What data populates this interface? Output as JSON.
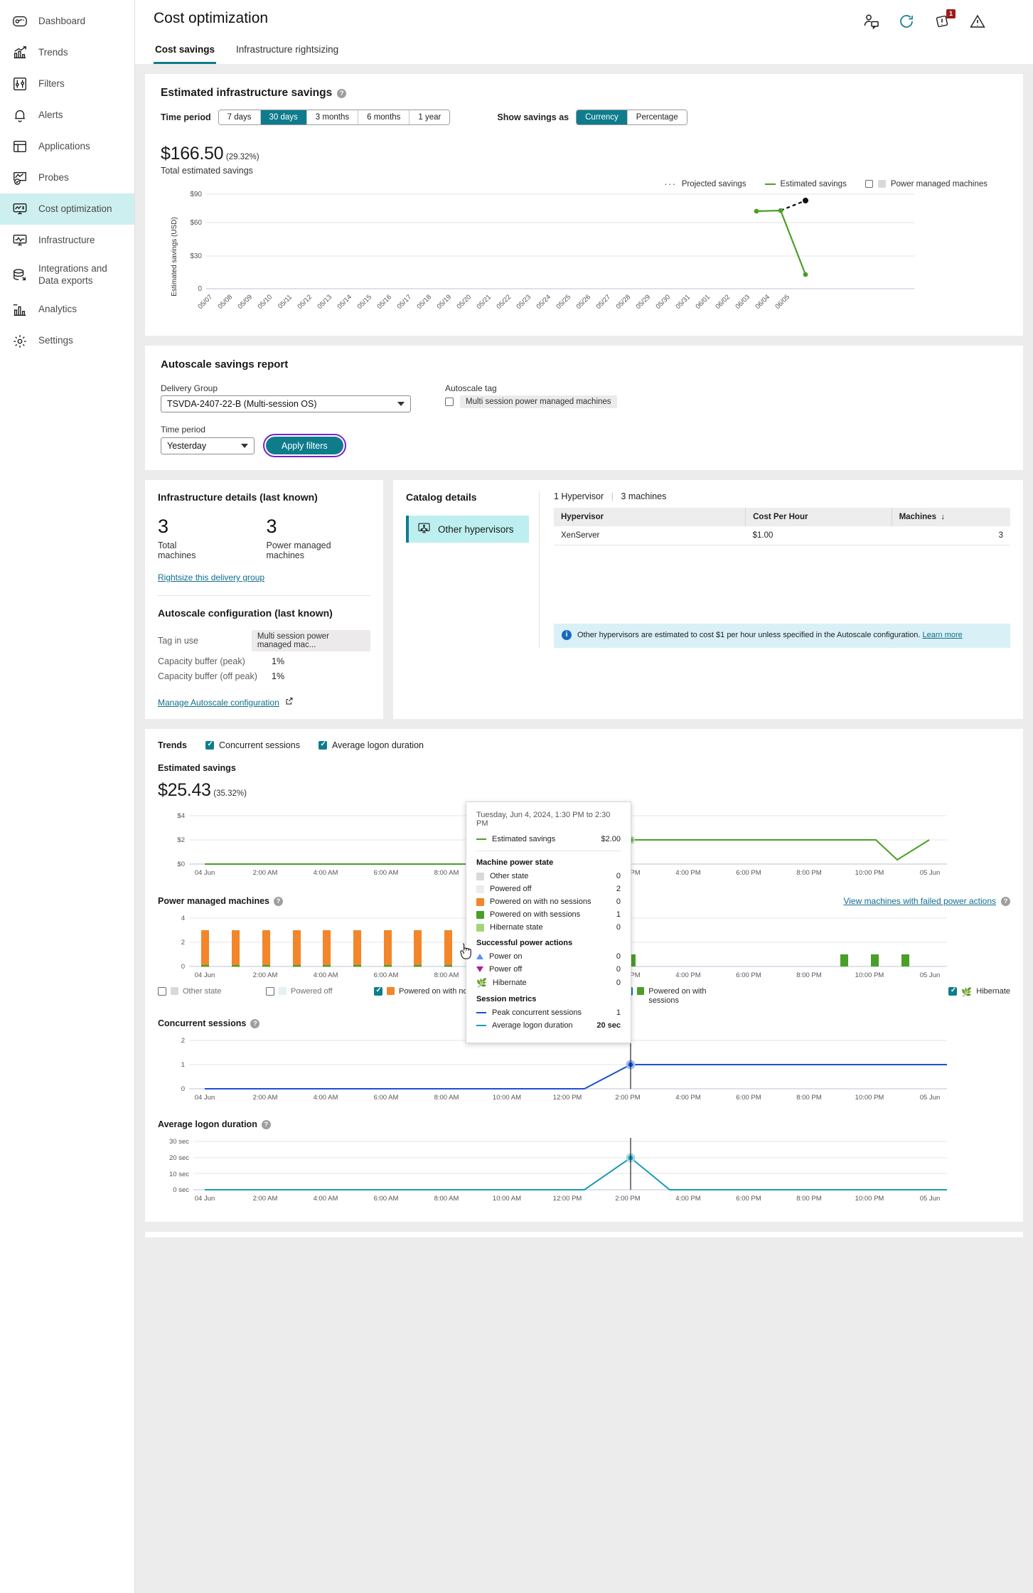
{
  "sidebar": {
    "items": [
      {
        "label": "Dashboard",
        "icon": "gauge-icon",
        "active": false
      },
      {
        "label": "Trends",
        "icon": "trend-chart-icon",
        "active": false
      },
      {
        "label": "Filters",
        "icon": "sliders-icon",
        "active": false
      },
      {
        "label": "Alerts",
        "icon": "bell-icon",
        "active": false
      },
      {
        "label": "Applications",
        "icon": "window-icon",
        "active": false
      },
      {
        "label": "Probes",
        "icon": "probe-check-icon",
        "active": false
      },
      {
        "label": "Cost optimization",
        "icon": "monitor-dollar-icon",
        "active": true
      },
      {
        "label": "Infrastructure",
        "icon": "monitor-pulse-icon",
        "active": false
      },
      {
        "label": "Integrations and Data exports",
        "icon": "stack-export-icon",
        "active": false
      },
      {
        "label": "Analytics",
        "icon": "analytics-bar-icon",
        "active": false
      },
      {
        "label": "Settings",
        "icon": "gear-icon",
        "active": false
      }
    ]
  },
  "header": {
    "title": "Cost optimization",
    "icons": [
      {
        "name": "user-feedback-icon",
        "badge": null
      },
      {
        "name": "refresh-icon",
        "badge": null
      },
      {
        "name": "alerts-diamond-icon",
        "badge": "1"
      },
      {
        "name": "warning-triangle-icon",
        "badge": null
      }
    ],
    "tabs": [
      {
        "label": "Cost savings",
        "active": true
      },
      {
        "label": "Infrastructure rightsizing",
        "active": false
      }
    ]
  },
  "infra_savings": {
    "title": "Estimated infrastructure savings",
    "time_period_label": "Time period",
    "time_periods": [
      "7 days",
      "30 days",
      "3 months",
      "6 months",
      "1 year"
    ],
    "time_period_selected": "30 days",
    "show_savings_label": "Show savings as",
    "savings_modes": [
      "Currency",
      "Percentage"
    ],
    "savings_mode_selected": "Currency",
    "total_value": "$166.50",
    "total_pct": "(29.32%)",
    "total_caption": "Total estimated savings",
    "legend": [
      {
        "label": "Projected savings",
        "style": "dotted"
      },
      {
        "label": "Estimated savings",
        "style": "line"
      },
      {
        "label": "Power managed machines",
        "style": "checkbox",
        "checked": false
      }
    ]
  },
  "autoscale_report": {
    "title": "Autoscale savings report",
    "delivery_group_label": "Delivery Group",
    "delivery_group_value": "TSVDA-2407-22-B (Multi-session OS)",
    "time_period_label": "Time period",
    "time_period_value": "Yesterday",
    "apply_button": "Apply filters",
    "autoscale_tag_label": "Autoscale tag",
    "autoscale_tag_value": "Multi session power managed machines",
    "autoscale_tag_checked": false
  },
  "infra_details": {
    "title": "Infrastructure details (last known)",
    "total_machines": "3",
    "total_machines_label": "Total machines",
    "power_managed": "3",
    "power_managed_label": "Power managed machines",
    "rightsize_link": "Rightsize this delivery group",
    "autoscale_config_title": "Autoscale configuration (last known)",
    "rows": [
      {
        "key": "Tag in use",
        "value": "Multi session power managed mac...",
        "pill": true
      },
      {
        "key": "Capacity buffer (peak)",
        "value": "1%",
        "pill": false
      },
      {
        "key": "Capacity buffer (off peak)",
        "value": "1%",
        "pill": false
      }
    ],
    "manage_link": "Manage Autoscale configuration"
  },
  "catalog_details": {
    "title": "Catalog details",
    "tile_label": "Other hypervisors",
    "summary_hypervisors": "1 Hypervisor",
    "summary_machines": "3 machines",
    "columns": [
      "Hypervisor",
      "Cost Per Hour",
      "Machines"
    ],
    "sort_column": "Machines",
    "rows": [
      {
        "hypervisor": "XenServer",
        "cost": "$1.00",
        "machines": "3"
      }
    ],
    "info_text": "Other hypervisors are estimated to cost $1 per hour unless specified in the Autoscale configuration.",
    "info_link": "Learn more"
  },
  "trends": {
    "label": "Trends",
    "toggles": [
      {
        "label": "Concurrent sessions",
        "checked": true
      },
      {
        "label": "Average logon duration",
        "checked": true
      }
    ],
    "est_savings_title": "Estimated savings",
    "est_savings_value": "$25.43",
    "est_savings_pct": "(35.32%)",
    "power_managed_title": "Power managed machines",
    "failed_actions_link": "View machines with failed power actions",
    "power_legend": [
      {
        "label": "Other state",
        "checked": false,
        "color": "#d9d9d9"
      },
      {
        "label": "Powered off",
        "checked": false,
        "color": "#e8e8e8"
      },
      {
        "label": "Powered on with no sessions",
        "checked": true,
        "color": "#f3852a"
      },
      {
        "label": "Hibernate state",
        "checked": true,
        "color": "#a2d678"
      },
      {
        "label": "Powered on with sessions",
        "checked": true,
        "color": "#4a9e29"
      },
      {
        "label": "Power on",
        "checked": true,
        "color": "#5b8ff9"
      },
      {
        "label": "Power off",
        "checked": true,
        "color": "#b5199c"
      },
      {
        "label": "Hibernate",
        "checked": true,
        "color": "#4a9e29"
      }
    ],
    "concurrent_sessions_title": "Concurrent sessions",
    "logon_duration_title": "Average logon duration"
  },
  "tooltip": {
    "date": "Tuesday, Jun 4, 2024, 1:30 PM to 2:30 PM",
    "estimated_savings_label": "Estimated savings",
    "estimated_savings_value": "$2.00",
    "power_state_header": "Machine power state",
    "power_states": [
      {
        "label": "Other state",
        "value": "0",
        "color": "#d9d9d9"
      },
      {
        "label": "Powered off",
        "value": "2",
        "color": "#ececec"
      },
      {
        "label": "Powered on with no sessions",
        "value": "0",
        "color": "#f3852a"
      },
      {
        "label": "Powered on with sessions",
        "value": "1",
        "color": "#4a9e29"
      },
      {
        "label": "Hibernate state",
        "value": "0",
        "color": "#a2d678"
      }
    ],
    "actions_header": "Successful power actions",
    "actions": [
      {
        "label": "Power on",
        "value": "0",
        "icon": "triangle-up-icon"
      },
      {
        "label": "Power off",
        "value": "0",
        "icon": "triangle-down-icon"
      },
      {
        "label": "Hibernate",
        "value": "0",
        "icon": "leaf-icon"
      }
    ],
    "metrics_header": "Session metrics",
    "metrics": [
      {
        "label": "Peak concurrent sessions",
        "value": "1",
        "color": "#1a4fd6"
      },
      {
        "label": "Average logon duration",
        "value": "20 sec",
        "color": "#1a9bb5"
      }
    ]
  },
  "chart_data": [
    {
      "type": "line",
      "id": "estimated-infrastructure-savings",
      "title": "Estimated infrastructure savings",
      "ylabel": "Estimated savings (USD)",
      "xlabel": "",
      "ylim": [
        0,
        90
      ],
      "yticks": [
        "0",
        "$30",
        "$60",
        "$90"
      ],
      "grid": true,
      "legend_position": "top-right",
      "categories": [
        "05/07",
        "05/08",
        "05/09",
        "05/10",
        "05/11",
        "05/12",
        "05/13",
        "05/14",
        "05/15",
        "05/16",
        "05/17",
        "05/18",
        "05/19",
        "05/20",
        "05/21",
        "05/22",
        "05/23",
        "05/24",
        "05/25",
        "05/26",
        "05/27",
        "05/28",
        "05/29",
        "05/30",
        "05/31",
        "06/01",
        "06/02",
        "06/03",
        "06/04",
        "06/05"
      ],
      "series": [
        {
          "name": "Estimated savings",
          "color": "#4a9e29",
          "values": [
            null,
            null,
            null,
            null,
            null,
            null,
            null,
            null,
            null,
            null,
            null,
            null,
            null,
            null,
            null,
            null,
            null,
            null,
            null,
            null,
            null,
            null,
            null,
            null,
            null,
            null,
            null,
            74,
            75,
            16
          ]
        },
        {
          "name": "Projected savings",
          "color": "#111111",
          "style": "dotted",
          "values": [
            null,
            null,
            null,
            null,
            null,
            null,
            null,
            null,
            null,
            null,
            null,
            null,
            null,
            null,
            null,
            null,
            null,
            null,
            null,
            null,
            null,
            null,
            null,
            null,
            null,
            null,
            null,
            null,
            75,
            81
          ]
        }
      ]
    },
    {
      "type": "line",
      "id": "trend-estimated-savings",
      "ylabel": "",
      "ylim": [
        0,
        4
      ],
      "yticks": [
        "$0",
        "$2",
        "$4"
      ],
      "xticks": [
        "04 Jun",
        "2:00 AM",
        "4:00 AM",
        "6:00 AM",
        "8:00 AM",
        "10:00 AM",
        "12:00 PM",
        "2:00 PM",
        "4:00 PM",
        "6:00 PM",
        "8:00 PM",
        "10:00 PM",
        "05 Jun"
      ],
      "series": [
        {
          "name": "Estimated savings",
          "color": "#4a9e29",
          "x": [
            0,
            1,
            2,
            3,
            4,
            5,
            6,
            7,
            8,
            9,
            9.8,
            11.2,
            12,
            13,
            14,
            15,
            16,
            17,
            18,
            19,
            20,
            21,
            21.6,
            22.2,
            23,
            23.6
          ],
          "values": [
            0,
            0,
            0,
            0,
            0,
            0,
            0,
            0,
            0,
            0,
            0,
            1.3,
            2.05,
            2.05,
            2.05,
            2.05,
            2.05,
            2.05,
            2.05,
            2.05,
            2.05,
            2.05,
            2.05,
            0.4,
            1.4,
            2.1
          ]
        }
      ],
      "marker": {
        "x": "1:30 PM",
        "value": 2.05
      }
    },
    {
      "type": "bar",
      "id": "power-managed-machines",
      "ylim": [
        0,
        4
      ],
      "yticks": [
        "0",
        "2",
        "4"
      ],
      "xticks": [
        "04 Jun",
        "2:00 AM",
        "4:00 AM",
        "6:00 AM",
        "8:00 AM",
        "10:00 AM",
        "12:00 PM",
        "2:00 PM",
        "4:00 PM",
        "6:00 PM",
        "8:00 PM",
        "10:00 PM",
        "05 Jun"
      ],
      "series": [
        {
          "name": "Powered on with no sessions",
          "color": "#f3852a",
          "values": [
            3,
            3,
            3,
            3,
            3,
            3,
            3,
            3,
            3,
            3,
            3,
            1,
            1,
            0,
            0,
            0,
            0,
            0,
            0,
            0,
            0,
            0,
            1,
            1,
            1,
            0
          ]
        },
        {
          "name": "Powered on with sessions",
          "color": "#4a9e29",
          "values": [
            0,
            0,
            0,
            0,
            0,
            0,
            0,
            0,
            0,
            0,
            0,
            0,
            0,
            1,
            1,
            1,
            1,
            1,
            1,
            1,
            1,
            1,
            0,
            0,
            0,
            1
          ]
        }
      ],
      "annotation": {
        "label": "Power off",
        "x_index": 10,
        "icon": "triangle-down-icon",
        "color": "#b5199c"
      }
    },
    {
      "type": "line",
      "id": "concurrent-sessions",
      "ylim": [
        0,
        2
      ],
      "yticks": [
        "0",
        "1",
        "2"
      ],
      "xticks": [
        "04 Jun",
        "2:00 AM",
        "4:00 AM",
        "6:00 AM",
        "8:00 AM",
        "10:00 AM",
        "12:00 PM",
        "2:00 PM",
        "4:00 PM",
        "6:00 PM",
        "8:00 PM",
        "10:00 PM",
        "05 Jun"
      ],
      "series": [
        {
          "name": "Peak concurrent sessions",
          "color": "#1a4fd6",
          "x": [
            0,
            1,
            2,
            3,
            4,
            5,
            6,
            7,
            8,
            9,
            10,
            11,
            12,
            12.8,
            13.4,
            14,
            16,
            18,
            20,
            21.6,
            22.4,
            23.6
          ],
          "values": [
            0,
            0,
            0,
            0,
            0,
            0,
            0,
            0,
            0,
            0,
            0,
            0,
            0,
            0,
            1,
            1,
            1,
            1,
            1,
            1,
            1,
            1
          ]
        }
      ],
      "marker": {
        "value": 1
      }
    },
    {
      "type": "line",
      "id": "average-logon-duration",
      "ylim": [
        0,
        30
      ],
      "yticks": [
        "0 sec",
        "10 sec",
        "20 sec",
        "30 sec"
      ],
      "xticks": [
        "04 Jun",
        "2:00 AM",
        "4:00 AM",
        "6:00 AM",
        "8:00 AM",
        "10:00 AM",
        "12:00 PM",
        "2:00 PM",
        "4:00 PM",
        "6:00 PM",
        "8:00 PM",
        "10:00 PM",
        "05 Jun"
      ],
      "series": [
        {
          "name": "Average logon duration",
          "color": "#1a9bb5",
          "x": [
            0,
            2,
            4,
            6,
            8,
            10,
            12,
            12.8,
            13.4,
            14,
            15,
            16,
            18,
            20,
            22,
            23.6
          ],
          "values": [
            0,
            0,
            0,
            0,
            0,
            0,
            0,
            0,
            20,
            0,
            0,
            0,
            0,
            0,
            0,
            0
          ]
        }
      ],
      "marker": {
        "value": 20
      }
    }
  ]
}
